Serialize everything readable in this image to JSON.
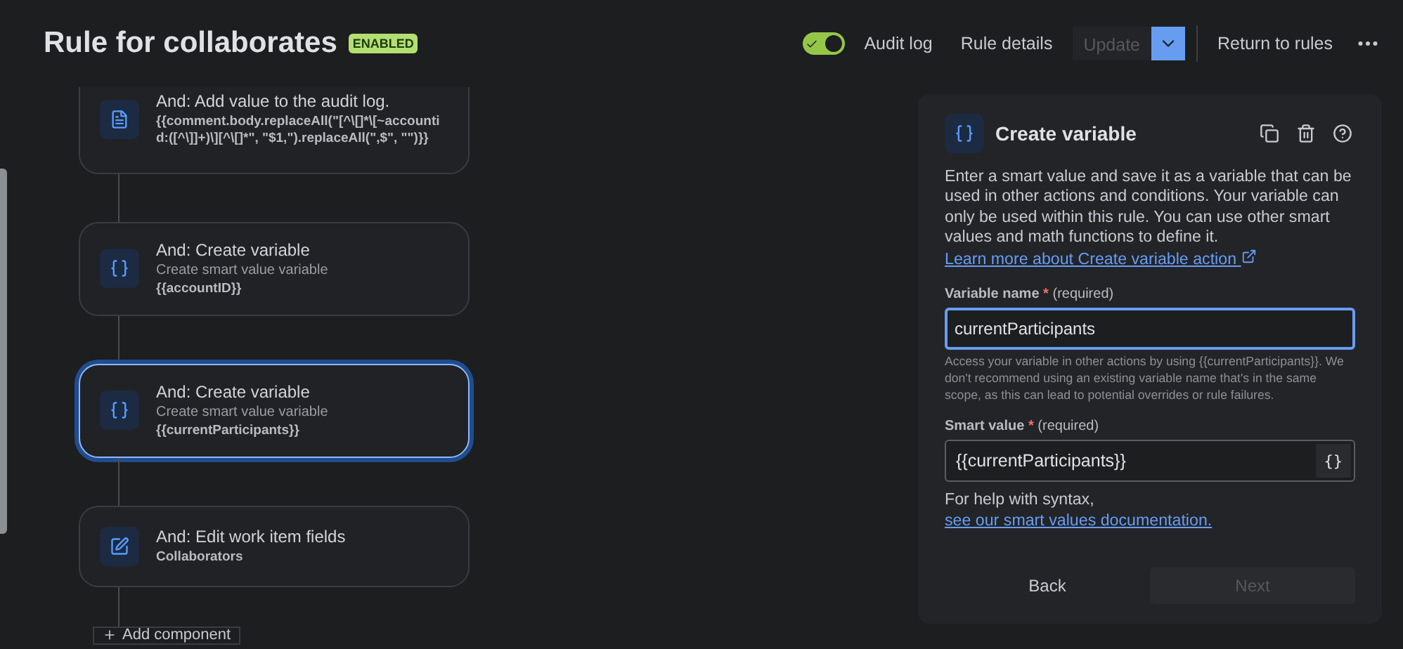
{
  "header": {
    "title": "Rule for collaborates",
    "badge": "ENABLED",
    "rule_toggle": {
      "on": true
    },
    "actions": [
      "Audit log",
      "Rule details"
    ],
    "update": {
      "label": "Update",
      "disabled": true
    },
    "return_link": "Return to rules"
  },
  "flow": {
    "steps": [
      {
        "kind": "log",
        "title": "And: Add value to the audit log.",
        "detail": "{{comment.body.replaceAll(\"[^\\[]*\\[~accountid:([^\\]]+)\\][^\\[]*\", \"$1,\").replaceAll(\",$\", \"\")}}",
        "selected": false
      },
      {
        "kind": "variable",
        "title": "And: Create variable",
        "subtitle": "Create smart value variable",
        "detail": "{{accountID}}",
        "selected": false
      },
      {
        "kind": "variable",
        "title": "And: Create variable",
        "subtitle": "Create smart value variable",
        "detail": "{{currentParticipants}}",
        "selected": true
      },
      {
        "kind": "edit",
        "title": "And: Edit work item fields",
        "detail": "Collaborators",
        "selected": false
      }
    ],
    "add_button": "Add component"
  },
  "panel": {
    "title": "Create variable",
    "description": "Enter a smart value and save it as a variable that can be used in other actions and conditions. Your variable can only be used within this rule. You can use other smart values and math functions to define it.",
    "description_link": "Learn more about Create variable action",
    "fields": [
      {
        "label": "Variable name",
        "required_mark": "*",
        "hint": "(required)",
        "value": "currentParticipants",
        "focused": true,
        "help": "Access your variable in other actions by using {{currentParticipants}}. We don't recommend using an existing variable name that's in the same scope, as this can lead to potential overrides or rule failures."
      },
      {
        "label": "Smart value",
        "required_mark": "*",
        "hint": "(required)",
        "value": "{{currentParticipants}}",
        "focused": false,
        "button": "{}"
      }
    ],
    "syntax_help": "For help with syntax,",
    "syntax_link": "see our smart values documentation.",
    "buttons": [
      {
        "label": "Back",
        "disabled": false
      },
      {
        "label": "Next",
        "disabled": true
      }
    ]
  }
}
